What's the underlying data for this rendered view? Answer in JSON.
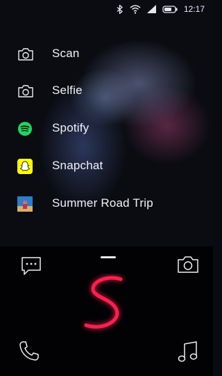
{
  "status_bar": {
    "time": "12:17",
    "icons": [
      "bluetooth-icon",
      "wifi-icon",
      "signal-icon",
      "battery-icon"
    ]
  },
  "menu": {
    "items": [
      {
        "label": "Scan",
        "icon": "camera-icon"
      },
      {
        "label": "Selfie",
        "icon": "camera-icon"
      },
      {
        "label": "Spotify",
        "icon": "spotify-icon"
      },
      {
        "label": "Snapchat",
        "icon": "snapchat-icon"
      },
      {
        "label": "Summer Road Trip",
        "icon": "album-art-icon"
      }
    ]
  },
  "dock": {
    "icons": [
      "message-icon",
      "camera-icon",
      "phone-icon",
      "music-icon"
    ],
    "gesture": "S",
    "gesture_color": "#ff1f4e"
  },
  "colors": {
    "spotify": "#1ed760",
    "snapchat": "#fffc00",
    "accent": "#ff1f4e"
  }
}
